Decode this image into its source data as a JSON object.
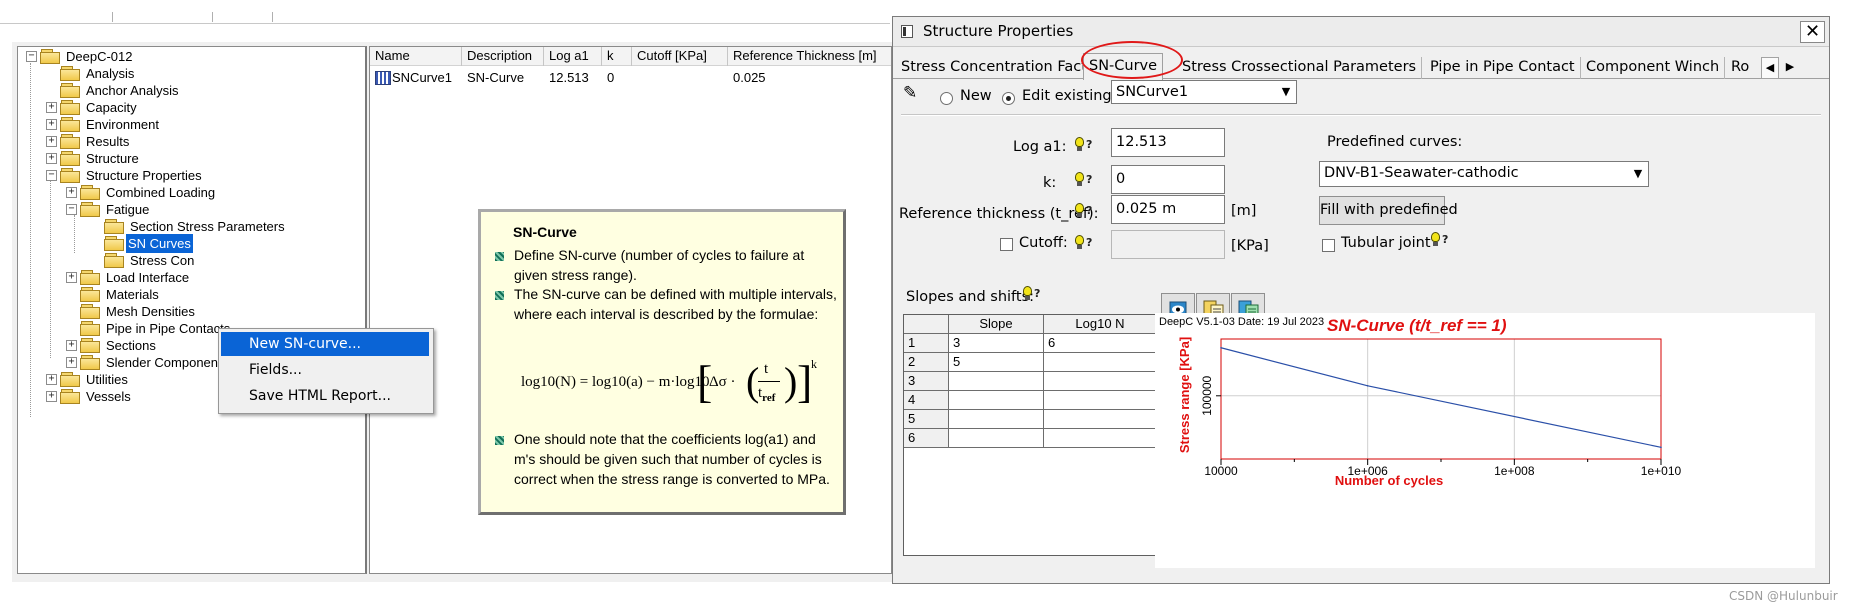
{
  "tree": {
    "root": "DeepC-012",
    "nodes": [
      "Analysis",
      "Anchor Analysis",
      "Capacity",
      "Environment",
      "Results",
      "Structure",
      "Structure Properties",
      "Combined Loading",
      "Fatigue",
      "Section Stress Parameters",
      "SN Curves",
      "Stress Con",
      "Load Interface",
      "Materials",
      "Mesh Densities",
      "Pipe in Pipe Contacts",
      "Sections",
      "Slender Components",
      "Utilities",
      "Vessels"
    ]
  },
  "list": {
    "columns": [
      "Name",
      "Description",
      "Log a1",
      "k",
      "Cutoff [KPa]",
      "Reference Thickness [m]"
    ],
    "rows": [
      {
        "name": "SNCurve1",
        "description": "SN-Curve",
        "log_a1": "12.513",
        "k": "0",
        "cutoff": "",
        "ref_thickness": "0.025"
      }
    ]
  },
  "context_menu": {
    "items": [
      "New SN-curve...",
      "Fields...",
      "Save HTML Report..."
    ]
  },
  "tooltip": {
    "title": "SN-Curve",
    "bullets": [
      "Define SN-curve (number of cycles to failure at given stress range).",
      "The SN-curve can be defined with multiple intervals, where each interval is described by the formulae:",
      "One should note that the coefficients log(a1) and m's should be given such that number of cycles is correct when the stress range is converted to MPa."
    ],
    "formula_left": "log10(N) = log10(a) − m·log10",
    "formula_delta": "Δσ ·",
    "formula_t": "t",
    "formula_tref": "t",
    "formula_tref_sub": "ref",
    "formula_k": "k"
  },
  "dialog": {
    "title": "Structure Properties",
    "close": "✕",
    "tabs": [
      "Stress Concentration Factor",
      "SN-Curve",
      "Stress Crossectional Parameters",
      "Pipe in Pipe Contact",
      "Component Winch",
      "Ro"
    ],
    "radio_new": "New",
    "radio_edit": "Edit existing",
    "existing_select": "SNCurve1",
    "log_a1_label": "Log a1:",
    "log_a1_value": "12.513",
    "k_label": "k:",
    "k_value": "0",
    "ref_thick_label": "Reference thickness (t_ref):",
    "ref_thick_value": "0.025 m",
    "ref_thick_unit": "[m]",
    "cutoff_label": "Cutoff:",
    "cutoff_value": "",
    "cutoff_unit": "[KPa]",
    "predef_label": "Predefined curves:",
    "predef_value": "DNV-B1-Seawater-cathodic",
    "fill_button": "Fill with predefined",
    "tubular_label": "Tubular joint",
    "slopes_label": "Slopes and shifts:",
    "bulb_q": "?",
    "grid_headers": [
      "Slope",
      "Log10 N"
    ],
    "grid_rows": [
      {
        "n": "1",
        "slope": "3",
        "logn": "6"
      },
      {
        "n": "2",
        "slope": "5",
        "logn": ""
      },
      {
        "n": "3",
        "slope": "",
        "logn": ""
      },
      {
        "n": "4",
        "slope": "",
        "logn": ""
      },
      {
        "n": "5",
        "slope": "",
        "logn": ""
      },
      {
        "n": "6",
        "slope": "",
        "logn": ""
      }
    ]
  },
  "chart_data": {
    "type": "line",
    "header_text": "DeepC V5.1-03 Date: 19 Jul 2023",
    "title": "SN-Curve (t/t_ref == 1)",
    "xlabel": "Number of cycles",
    "ylabel": "Stress range [KPa]",
    "xscale": "log",
    "yscale": "log",
    "xlim": [
      10000,
      10000000000
    ],
    "ylim": [
      15000,
      550000
    ],
    "x_ticks": [
      "10000",
      "1e+006",
      "1e+008",
      "1e+010"
    ],
    "y_ticks": [
      "100000"
    ],
    "grid": true,
    "series": [
      {
        "x": [
          10000,
          1000000,
          10000000000
        ],
        "y": [
          423000,
          135000,
          21300
        ],
        "color": "#2a4fa8"
      }
    ],
    "title_color": "#e01010",
    "label_color": "#e01010"
  },
  "watermark": "CSDN @Hulunbuir"
}
